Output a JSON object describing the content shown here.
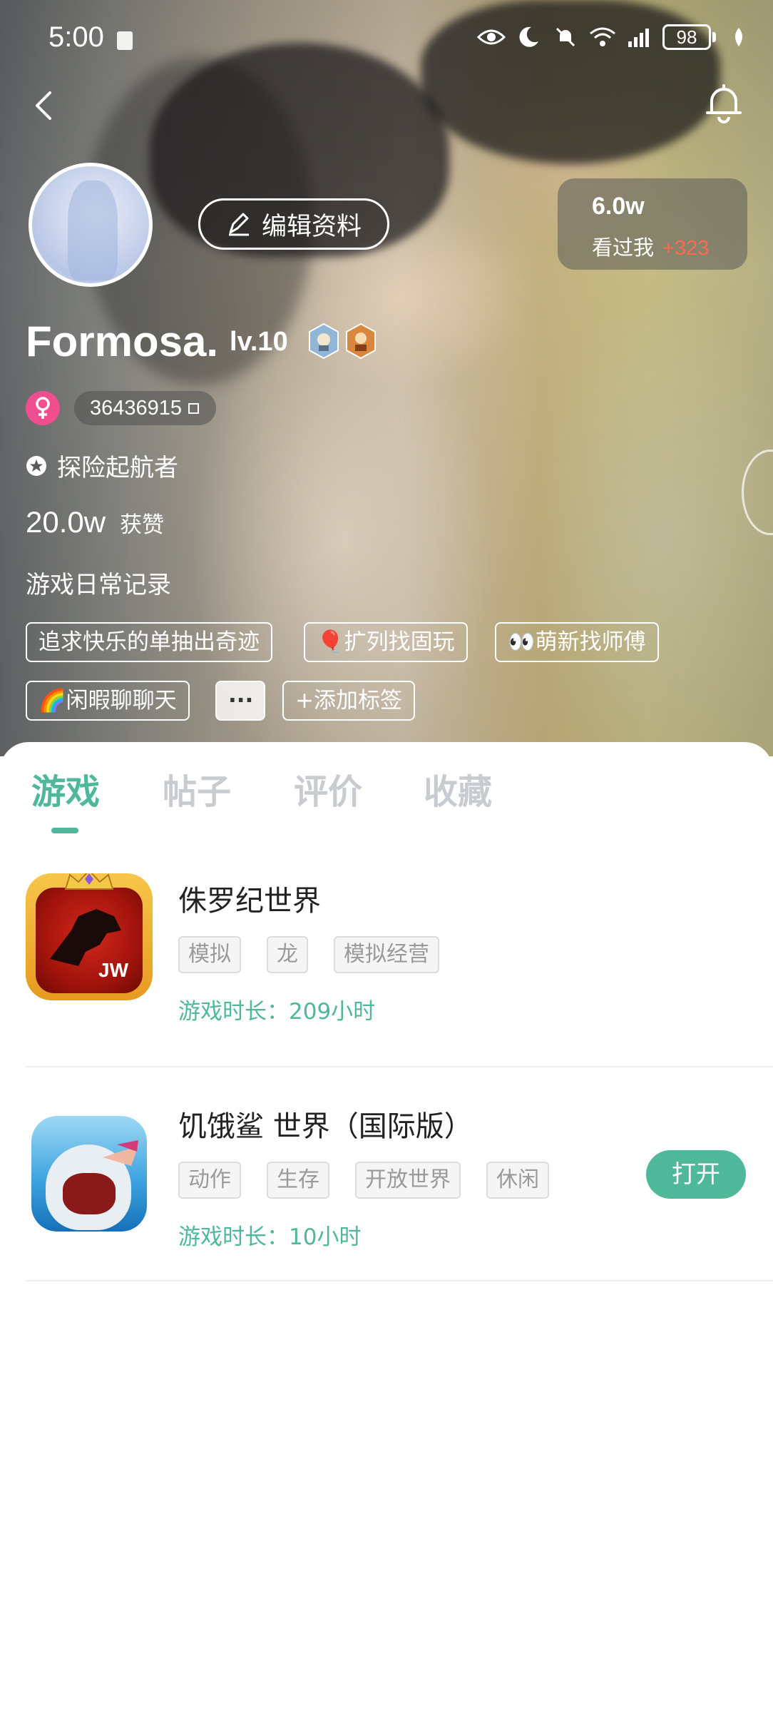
{
  "status_bar": {
    "time": "5:00",
    "battery": "98"
  },
  "profile": {
    "edit_label": "编辑资料",
    "views_count": "6.0w",
    "views_label": "看过我",
    "views_increase": "+323",
    "name": "Formosa.",
    "level": "lv.10",
    "uid": "36436915",
    "title": "探险起航者",
    "likes_value": "20.0w",
    "likes_label": "获赞",
    "bio": "游戏日常记录",
    "tags": [
      "追求快乐的单抽出奇迹",
      "🎈扩列找固玩",
      "👀萌新找师傅",
      "🌈闲暇聊聊天"
    ],
    "more_tag": "···",
    "add_tag": "+添加标签"
  },
  "tabs": [
    "游戏",
    "帖子",
    "评价",
    "收藏"
  ],
  "games": [
    {
      "name": "侏罗纪世界",
      "tags": [
        "模拟",
        "龙",
        "模拟经营"
      ],
      "playtime": "游戏时长：209小时",
      "icon_text": "JW"
    },
    {
      "name": "饥饿鲨 世界（国际版）",
      "tags": [
        "动作",
        "生存",
        "开放世界",
        "休闲"
      ],
      "playtime": "游戏时长：10小时",
      "action": "打开"
    }
  ],
  "colors": {
    "accent": "#4fb89a",
    "increase": "#ff6a50",
    "gender_female": "#f04e8f"
  }
}
